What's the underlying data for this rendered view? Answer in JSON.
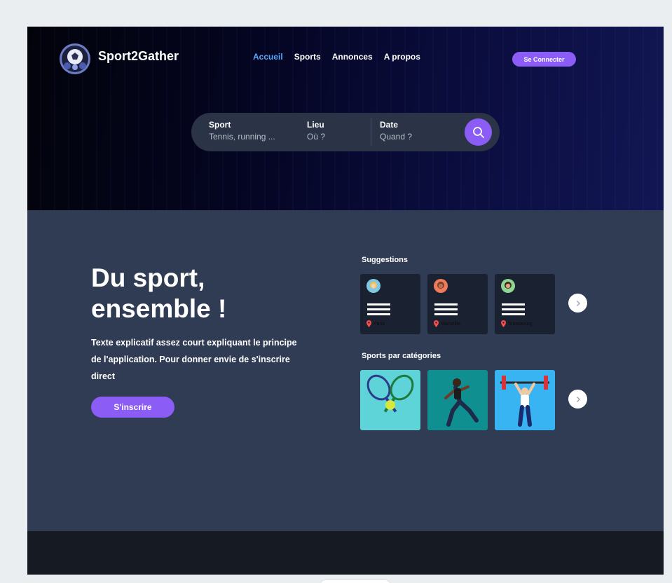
{
  "brand": {
    "name": "Sport2Gather",
    "logo_icon": "soccer-ball-logo-icon"
  },
  "nav": {
    "items": [
      {
        "label": "Accueil",
        "active": true
      },
      {
        "label": "Sports",
        "active": false
      },
      {
        "label": "Annonces",
        "active": false
      },
      {
        "label": "A propos",
        "active": false
      }
    ]
  },
  "header": {
    "connect_label": "Se Connecter"
  },
  "search": {
    "sport_label": "Sport",
    "sport_placeholder": "Tennis, running ...",
    "lieu_label": "Lieu",
    "lieu_placeholder": "Où ?",
    "date_label": "Date",
    "date_placeholder": "Quand ?",
    "button_icon": "search-icon"
  },
  "hero": {
    "headline_line1": "Du sport,",
    "headline_line2": "ensemble !",
    "subtext": "Texte explicatif assez court expliquant le principe de l'application. Pour donner envie de s'inscrire direct",
    "signup_label": "S'inscrire"
  },
  "suggestions": {
    "title": "Suggestions",
    "cards": [
      {
        "location": "Paris",
        "avatar_color": "#f2c14e",
        "avatar_bg": "#7ec8e3"
      },
      {
        "location": "Marseille",
        "avatar_color": "#7a3b2e",
        "avatar_bg": "#f07a5a"
      },
      {
        "location": "Strasbourg",
        "avatar_color": "#3a2a1e",
        "avatar_bg": "#8fd694"
      }
    ],
    "next_icon": "chevron-right-icon"
  },
  "categories": {
    "title": "Sports par catégories",
    "cards": [
      {
        "name": "tennis",
        "bg": "#5ed3d8"
      },
      {
        "name": "running",
        "bg": "#0f8f8f"
      },
      {
        "name": "weightlifting",
        "bg": "#38b4f2"
      }
    ],
    "next_icon": "chevron-right-icon"
  },
  "colors": {
    "accent": "#8b5cf6",
    "nav_active": "#56a8ff",
    "main_bg": "#2f3c53",
    "footer_bg": "#151a23"
  }
}
